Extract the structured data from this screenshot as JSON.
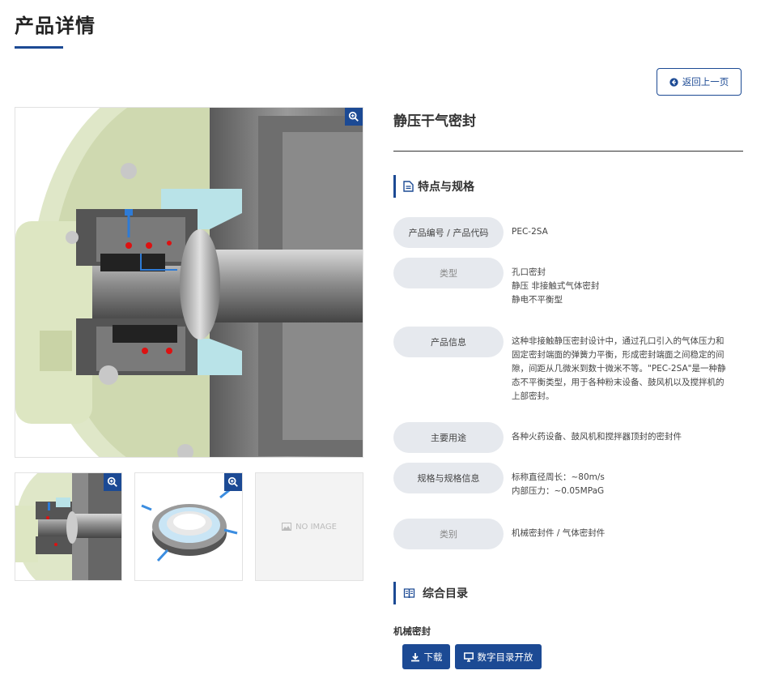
{
  "page": {
    "title": "产品详情"
  },
  "back_button": {
    "label": "返回上一页"
  },
  "gallery": {
    "main_alt": "静压干气密封 剖面图",
    "no_image_label": "NO IMAGE"
  },
  "product": {
    "name": "静压干气密封",
    "features_heading": "特点与规格",
    "specs": [
      {
        "label": "产品编号 / 产品代码",
        "values": [
          "PEC-2SA"
        ]
      },
      {
        "label": "类型",
        "values": [
          "孔口密封",
          "静压 非接触式气体密封",
          "静电不平衡型"
        ]
      },
      {
        "label": "产品信息",
        "values": [
          "这种非接触静压密封设计中，通过孔口引入的气体压力和",
          "固定密封端面的弹簧力平衡，形成密封端面之间稳定的间",
          "隙，间距从几微米到数十微米不等。\"PEC-2SA\"是一种静",
          "态不平衡类型，用于各种粉末设备、鼓风机以及搅拌机的",
          "上部密封。"
        ]
      },
      {
        "label": "主要用途",
        "values": [
          "各种火药设备、鼓风机和搅拌器顶封的密封件"
        ]
      },
      {
        "label": "规格与规格信息",
        "values": [
          "标称直径周长：~80m/s",
          "内部压力：~0.05MPaG"
        ]
      },
      {
        "label": "类别",
        "values": [
          "机械密封件 / 气体密封件"
        ]
      }
    ]
  },
  "catalog": {
    "heading": "综合目录",
    "category": "机械密封",
    "download_label": "下载",
    "digital_label": "数字目录开放"
  },
  "colors": {
    "accent": "#1c4a94",
    "pill": "#e6e9ee",
    "text": "#333333"
  }
}
